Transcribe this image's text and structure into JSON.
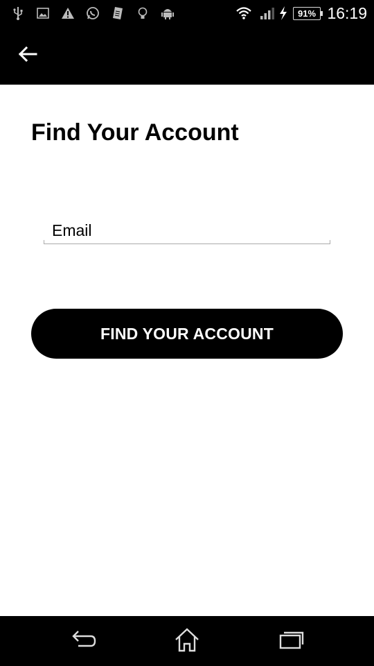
{
  "status_bar": {
    "battery_percent": "91%",
    "time": "16:19",
    "icons": [
      "usb-icon",
      "image-icon",
      "warning-icon",
      "whatsapp-icon",
      "sim-icon",
      "lightbulb-icon",
      "android-icon",
      "wifi-icon",
      "signal-icon",
      "charging-icon"
    ]
  },
  "app_bar": {
    "back_icon": "arrow-left-icon"
  },
  "main": {
    "title": "Find Your Account",
    "email_placeholder": "Email",
    "email_value": "",
    "submit_label": "FIND YOUR ACCOUNT"
  },
  "nav_bar": {
    "icons": [
      "back-nav-icon",
      "home-icon",
      "recents-icon"
    ]
  },
  "colors": {
    "bars": "#000000",
    "background": "#ffffff",
    "button": "#000000",
    "button_text": "#ffffff"
  }
}
